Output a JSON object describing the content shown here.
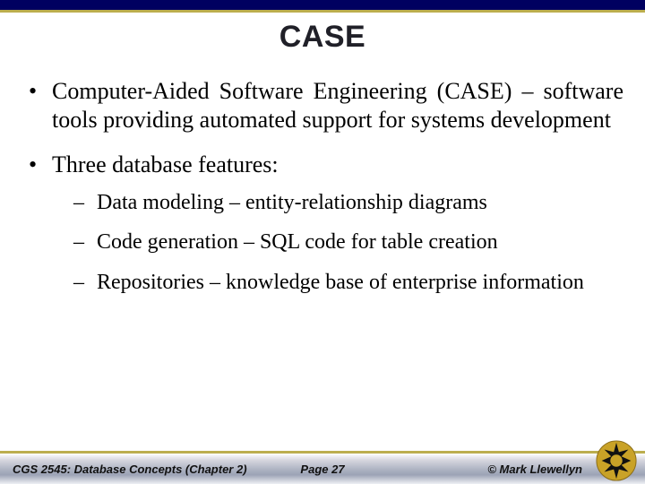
{
  "title": "CASE",
  "bullets": {
    "b1": "Computer-Aided Software Engineering (CASE) – software tools providing automated support for systems development",
    "b2": "Three database features:",
    "s1": "Data modeling – entity-relationship diagrams",
    "s2": "Code generation – SQL code for table creation",
    "s3": "Repositories – knowledge base of enterprise information"
  },
  "footer": {
    "left": "CGS 2545: Database Concepts (Chapter 2)",
    "page": "Page 27",
    "right": "© Mark Llewellyn"
  }
}
